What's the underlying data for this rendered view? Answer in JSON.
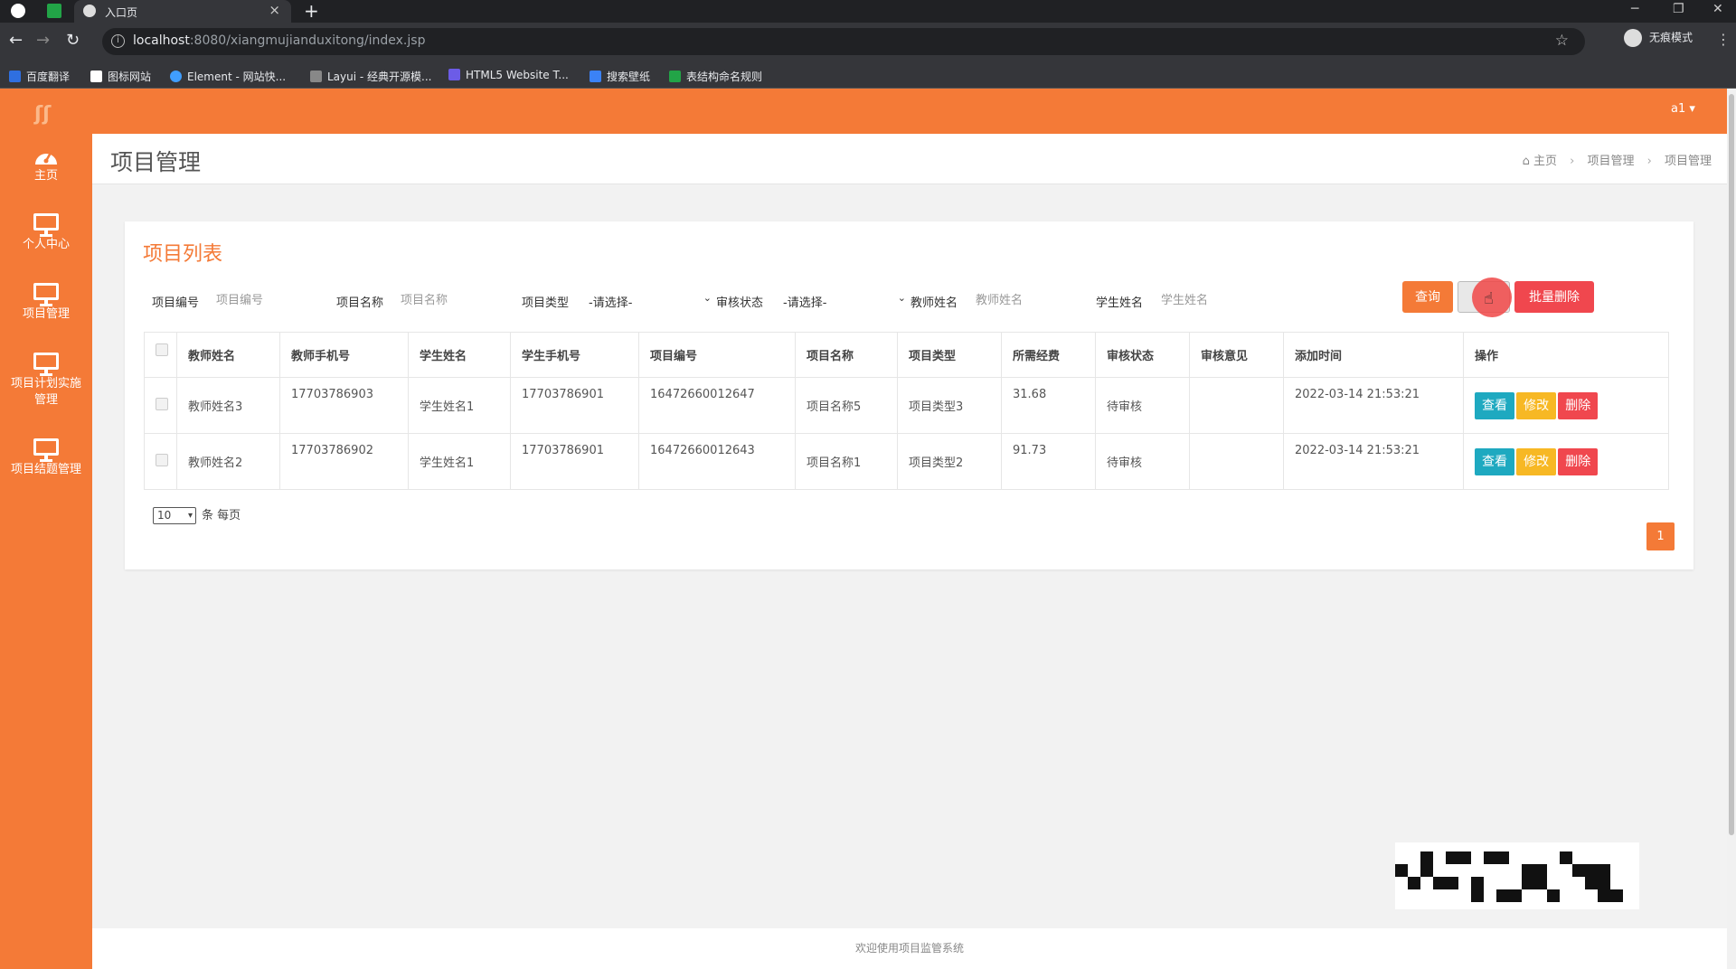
{
  "browser": {
    "tab_title": "入口页",
    "tab_close": "×",
    "new_tab": "+",
    "url_host": "localhost",
    "url_path": ":8080/xiangmujianduxitong/index.jsp",
    "incognito_label": "无痕模式",
    "bookmarks": [
      {
        "label": "百度翻译",
        "color": "#2f6fe0"
      },
      {
        "label": "图标网站",
        "color": "#ffffff"
      },
      {
        "label": "Element - 网站快...",
        "color": "#409eff"
      },
      {
        "label": "Layui - 经典开源模...",
        "color": "#cccccc"
      },
      {
        "label": "HTML5 Website T...",
        "color": "#6c5ce7"
      },
      {
        "label": "搜索壁纸",
        "color": "#3b82f6"
      },
      {
        "label": "表结构命名规则",
        "color": "#22a447"
      }
    ]
  },
  "app": {
    "logo": "ʃʃ",
    "user": "a1 ▾",
    "accent": "#f47a37"
  },
  "sidebar": {
    "items": [
      {
        "label": "主页",
        "icon": "dashboard-icon"
      },
      {
        "label": "个人中心",
        "icon": "monitor-icon"
      },
      {
        "label": "项目管理",
        "icon": "monitor-icon"
      },
      {
        "label": "项目计划实施管理",
        "icon": "monitor-icon"
      },
      {
        "label": "项目结题管理",
        "icon": "monitor-icon"
      }
    ]
  },
  "page": {
    "title": "项目管理",
    "breadcrumb": [
      "主页",
      "项目管理",
      "项目管理"
    ]
  },
  "card": {
    "title": "项目列表",
    "filters": {
      "project_no_label": "项目编号",
      "project_no_placeholder": "项目编号",
      "project_name_label": "项目名称",
      "project_name_placeholder": "项目名称",
      "project_type_label": "项目类型",
      "project_type_value": "-请选择-",
      "audit_status_label": "审核状态",
      "audit_status_value": "-请选择-",
      "teacher_name_label": "教师姓名",
      "teacher_name_placeholder": "教师姓名",
      "student_name_label": "学生姓名",
      "student_name_placeholder": "学生姓名"
    },
    "buttons": {
      "query": "查询",
      "add": "",
      "batch_delete": "批量删除"
    }
  },
  "table": {
    "columns": [
      "教师姓名",
      "教师手机号",
      "学生姓名",
      "学生手机号",
      "项目编号",
      "项目名称",
      "项目类型",
      "所需经费",
      "审核状态",
      "审核意见",
      "添加时间",
      "操作"
    ],
    "rows": [
      {
        "teacher": "教师姓名3",
        "teacher_phone": "17703786903",
        "student": "学生姓名1",
        "student_phone": "17703786901",
        "project_no": "16472660012647",
        "project_name": "项目名称5",
        "project_type": "项目类型3",
        "budget": "31.68",
        "status": "待审核",
        "opinion": "",
        "added": "2022-03-14 21:53:21"
      },
      {
        "teacher": "教师姓名2",
        "teacher_phone": "17703786902",
        "student": "学生姓名1",
        "student_phone": "17703786901",
        "project_no": "16472660012643",
        "project_name": "项目名称1",
        "project_type": "项目类型2",
        "budget": "91.73",
        "status": "待审核",
        "opinion": "",
        "added": "2022-03-14 21:53:21"
      }
    ],
    "ops": {
      "view": "查看",
      "edit": "修改",
      "delete": "删除"
    }
  },
  "pager": {
    "page_size": "10",
    "per_page_label": "条 每页",
    "current_page": "1"
  },
  "footer": {
    "text": "欢迎使用项目监管系统"
  }
}
